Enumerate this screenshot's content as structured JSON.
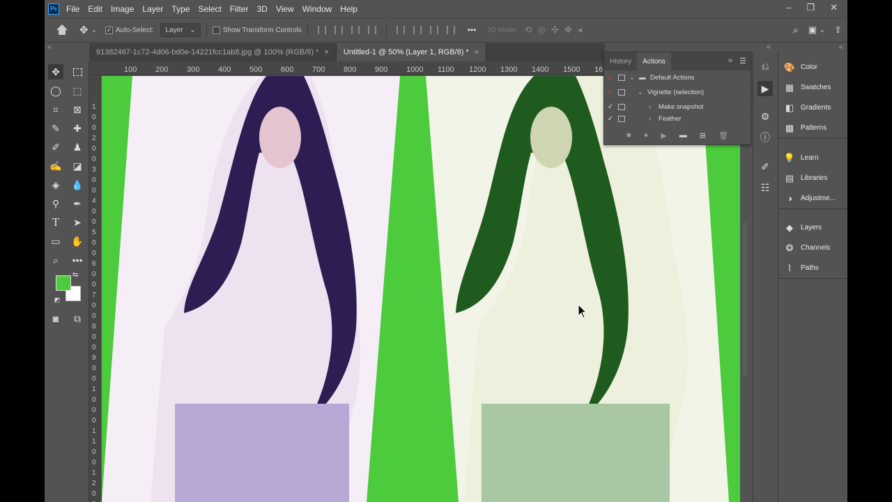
{
  "app": {
    "logo": "Ps"
  },
  "menu": [
    "File",
    "Edit",
    "Image",
    "Layer",
    "Type",
    "Select",
    "Filter",
    "3D",
    "View",
    "Window",
    "Help"
  ],
  "window_controls": [
    "–",
    "❐",
    "✕"
  ],
  "options": {
    "auto_select_label": "Auto-Select:",
    "auto_select_value": "Layer",
    "transform_controls_label": "Show Transform Controls",
    "mode_3d": "3D Mode:",
    "more": "•••"
  },
  "tabs": [
    {
      "label": "91382467-1c72-4d06-bd0e-14221fcc1ab8.jpg @ 100% (RGB/8) *",
      "active": false
    },
    {
      "label": "Untitled-1 @ 50% (Layer 1, RGB/8) *",
      "active": true
    }
  ],
  "ruler_top": [
    "100",
    "200",
    "300",
    "400",
    "500",
    "600",
    "700",
    "800",
    "900",
    "1000",
    "1100",
    "1200",
    "1300",
    "1400",
    "1500",
    "16"
  ],
  "ruler_left": [
    "1",
    "0",
    "0",
    "2",
    "0",
    "0",
    "3",
    "0",
    "0",
    "4",
    "0",
    "0",
    "5",
    "0",
    "0",
    "6",
    "0",
    "0",
    "7",
    "0",
    "0",
    "8",
    "0",
    "0",
    "9",
    "0",
    "0",
    "1",
    "0",
    "0",
    "0",
    "1",
    "1",
    "0",
    "0",
    "1",
    "2",
    "0",
    "0"
  ],
  "panel": {
    "tabs": [
      "History",
      "Actions"
    ],
    "active_tab": "Actions",
    "rows": [
      {
        "check": "✓",
        "expand": "v",
        "folder": true,
        "label": "Default Actions"
      },
      {
        "check": "✓",
        "expand": "v",
        "folder": false,
        "label": "Vignette (selection)"
      },
      {
        "check": "✓",
        "expand": "›",
        "folder": false,
        "label": "Make snapshot"
      },
      {
        "check": "✓",
        "expand": "›",
        "folder": false,
        "label": "Feather"
      }
    ]
  },
  "right_panels": [
    {
      "label": "Color",
      "icon": "palette-icon"
    },
    {
      "label": "Swatches",
      "icon": "grid-icon"
    },
    {
      "label": "Gradients",
      "icon": "gradient-icon"
    },
    {
      "label": "Patterns",
      "icon": "pattern-icon"
    },
    {
      "label": "Learn",
      "icon": "bulb-icon"
    },
    {
      "label": "Libraries",
      "icon": "library-icon"
    },
    {
      "label": "Adjustme...",
      "icon": "half-circle-icon"
    },
    {
      "label": "Layers",
      "icon": "layers-icon"
    },
    {
      "label": "Channels",
      "icon": "channels-icon"
    },
    {
      "label": "Paths",
      "icon": "paths-icon"
    }
  ],
  "colors": {
    "foreground": "#4ccc3c",
    "background": "#ffffff",
    "canvas_green": "#4ccc3c",
    "ui_bg": "#535353"
  }
}
